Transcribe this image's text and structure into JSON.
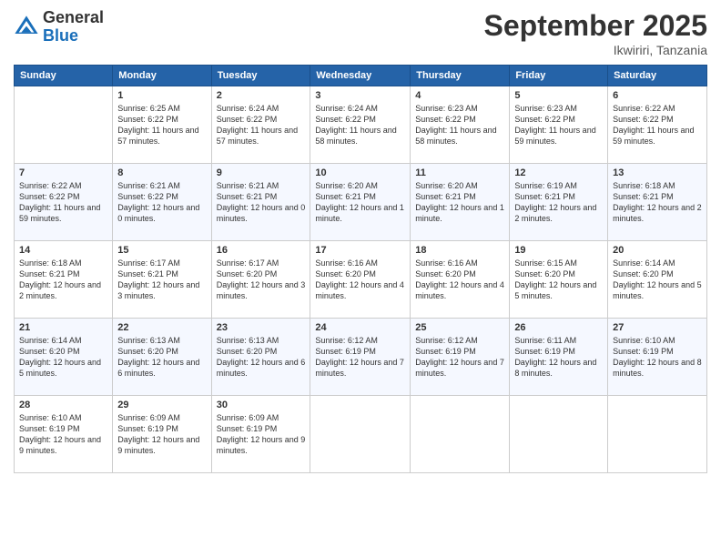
{
  "header": {
    "logo_general": "General",
    "logo_blue": "Blue",
    "month_title": "September 2025",
    "location": "Ikwiriri, Tanzania"
  },
  "days_of_week": [
    "Sunday",
    "Monday",
    "Tuesday",
    "Wednesday",
    "Thursday",
    "Friday",
    "Saturday"
  ],
  "weeks": [
    [
      {
        "day": "",
        "info": ""
      },
      {
        "day": "1",
        "info": "Sunrise: 6:25 AM\nSunset: 6:22 PM\nDaylight: 11 hours\nand 57 minutes."
      },
      {
        "day": "2",
        "info": "Sunrise: 6:24 AM\nSunset: 6:22 PM\nDaylight: 11 hours\nand 57 minutes."
      },
      {
        "day": "3",
        "info": "Sunrise: 6:24 AM\nSunset: 6:22 PM\nDaylight: 11 hours\nand 58 minutes."
      },
      {
        "day": "4",
        "info": "Sunrise: 6:23 AM\nSunset: 6:22 PM\nDaylight: 11 hours\nand 58 minutes."
      },
      {
        "day": "5",
        "info": "Sunrise: 6:23 AM\nSunset: 6:22 PM\nDaylight: 11 hours\nand 59 minutes."
      },
      {
        "day": "6",
        "info": "Sunrise: 6:22 AM\nSunset: 6:22 PM\nDaylight: 11 hours\nand 59 minutes."
      }
    ],
    [
      {
        "day": "7",
        "info": "Sunrise: 6:22 AM\nSunset: 6:22 PM\nDaylight: 11 hours\nand 59 minutes."
      },
      {
        "day": "8",
        "info": "Sunrise: 6:21 AM\nSunset: 6:22 PM\nDaylight: 12 hours\nand 0 minutes."
      },
      {
        "day": "9",
        "info": "Sunrise: 6:21 AM\nSunset: 6:21 PM\nDaylight: 12 hours\nand 0 minutes."
      },
      {
        "day": "10",
        "info": "Sunrise: 6:20 AM\nSunset: 6:21 PM\nDaylight: 12 hours\nand 1 minute."
      },
      {
        "day": "11",
        "info": "Sunrise: 6:20 AM\nSunset: 6:21 PM\nDaylight: 12 hours\nand 1 minute."
      },
      {
        "day": "12",
        "info": "Sunrise: 6:19 AM\nSunset: 6:21 PM\nDaylight: 12 hours\nand 2 minutes."
      },
      {
        "day": "13",
        "info": "Sunrise: 6:18 AM\nSunset: 6:21 PM\nDaylight: 12 hours\nand 2 minutes."
      }
    ],
    [
      {
        "day": "14",
        "info": "Sunrise: 6:18 AM\nSunset: 6:21 PM\nDaylight: 12 hours\nand 2 minutes."
      },
      {
        "day": "15",
        "info": "Sunrise: 6:17 AM\nSunset: 6:21 PM\nDaylight: 12 hours\nand 3 minutes."
      },
      {
        "day": "16",
        "info": "Sunrise: 6:17 AM\nSunset: 6:20 PM\nDaylight: 12 hours\nand 3 minutes."
      },
      {
        "day": "17",
        "info": "Sunrise: 6:16 AM\nSunset: 6:20 PM\nDaylight: 12 hours\nand 4 minutes."
      },
      {
        "day": "18",
        "info": "Sunrise: 6:16 AM\nSunset: 6:20 PM\nDaylight: 12 hours\nand 4 minutes."
      },
      {
        "day": "19",
        "info": "Sunrise: 6:15 AM\nSunset: 6:20 PM\nDaylight: 12 hours\nand 5 minutes."
      },
      {
        "day": "20",
        "info": "Sunrise: 6:14 AM\nSunset: 6:20 PM\nDaylight: 12 hours\nand 5 minutes."
      }
    ],
    [
      {
        "day": "21",
        "info": "Sunrise: 6:14 AM\nSunset: 6:20 PM\nDaylight: 12 hours\nand 5 minutes."
      },
      {
        "day": "22",
        "info": "Sunrise: 6:13 AM\nSunset: 6:20 PM\nDaylight: 12 hours\nand 6 minutes."
      },
      {
        "day": "23",
        "info": "Sunrise: 6:13 AM\nSunset: 6:20 PM\nDaylight: 12 hours\nand 6 minutes."
      },
      {
        "day": "24",
        "info": "Sunrise: 6:12 AM\nSunset: 6:19 PM\nDaylight: 12 hours\nand 7 minutes."
      },
      {
        "day": "25",
        "info": "Sunrise: 6:12 AM\nSunset: 6:19 PM\nDaylight: 12 hours\nand 7 minutes."
      },
      {
        "day": "26",
        "info": "Sunrise: 6:11 AM\nSunset: 6:19 PM\nDaylight: 12 hours\nand 8 minutes."
      },
      {
        "day": "27",
        "info": "Sunrise: 6:10 AM\nSunset: 6:19 PM\nDaylight: 12 hours\nand 8 minutes."
      }
    ],
    [
      {
        "day": "28",
        "info": "Sunrise: 6:10 AM\nSunset: 6:19 PM\nDaylight: 12 hours\nand 9 minutes."
      },
      {
        "day": "29",
        "info": "Sunrise: 6:09 AM\nSunset: 6:19 PM\nDaylight: 12 hours\nand 9 minutes."
      },
      {
        "day": "30",
        "info": "Sunrise: 6:09 AM\nSunset: 6:19 PM\nDaylight: 12 hours\nand 9 minutes."
      },
      {
        "day": "",
        "info": ""
      },
      {
        "day": "",
        "info": ""
      },
      {
        "day": "",
        "info": ""
      },
      {
        "day": "",
        "info": ""
      }
    ]
  ]
}
